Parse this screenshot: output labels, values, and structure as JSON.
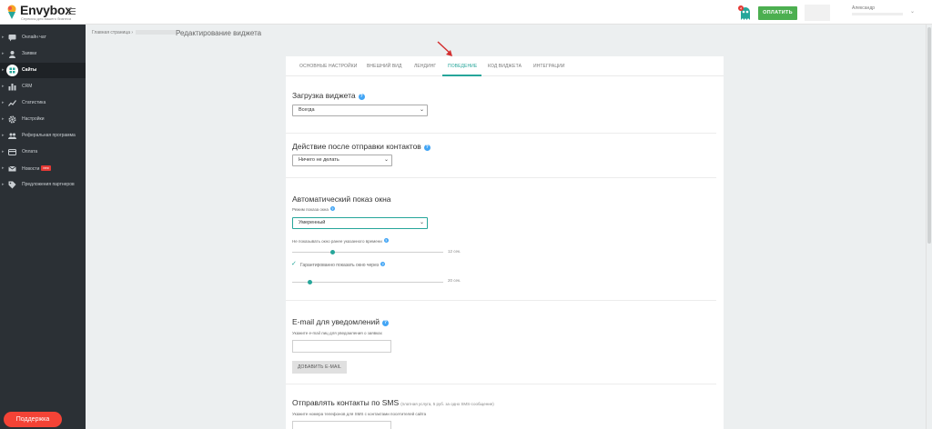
{
  "app": {
    "logo": "Envybox",
    "tagline": "Сервисы для вашего бизнеса",
    "colors": {
      "accent": "#26a69a",
      "sidebar": "#2b3035",
      "pay": "#4caf50",
      "support": "#f44336"
    }
  },
  "header": {
    "pay_label": "ОПЛАТИТЬ",
    "user_name": "Александр",
    "mascot_icon": "ghost-mascot-icon",
    "mascot_badge": "4"
  },
  "sidebar": {
    "items": [
      {
        "label": "Онлайн чат",
        "icon": "chat-icon"
      },
      {
        "label": "Заявки",
        "icon": "user-icon"
      },
      {
        "label": "Сайты",
        "icon": "grid-icon",
        "active": true
      },
      {
        "label": "CRM",
        "icon": "crm-icon"
      },
      {
        "label": "Статистика",
        "icon": "chart-icon"
      },
      {
        "label": "Настройки",
        "icon": "gear-icon"
      },
      {
        "label": "Реферальная программа",
        "icon": "people-icon"
      },
      {
        "label": "Оплата",
        "icon": "card-icon"
      },
      {
        "label": "Новости",
        "icon": "mail-icon",
        "badge": "new"
      },
      {
        "label": "Предложения партнеров",
        "icon": "tag-icon"
      }
    ],
    "support_label": "Поддержка"
  },
  "breadcrumb": {
    "home": "Главная страница",
    "title": "Редактирование виджета"
  },
  "tabs": [
    {
      "label": "ОСНОВНЫЕ НАСТРОЙКИ"
    },
    {
      "label": "ВНЕШНИЙ ВИД"
    },
    {
      "label": "ЛЕНДИНГ"
    },
    {
      "label": "ПОВЕДЕНИЕ",
      "active": true
    },
    {
      "label": "КОД ВИДЖЕТА"
    },
    {
      "label": "ИНТЕГРАЦИИ"
    }
  ],
  "sections": {
    "load": {
      "title": "Загрузка виджета",
      "value": "Всегда"
    },
    "after_submit": {
      "title": "Действие после отправки контактов",
      "value": "Ничего не делать"
    },
    "auto_show": {
      "title": "Автоматический показ окна",
      "mode_label": "Режим показа окна",
      "mode_value": "Умеренный",
      "min_time_label": "Не показывать окно ранее указанного времени",
      "min_time_value": "12 сек.",
      "min_time_fraction": 0.27,
      "guaranteed_label": "Гарантированно показать окно через",
      "guaranteed_checked": true,
      "guaranteed_value": "20 сек.",
      "guaranteed_fraction": 0.12
    },
    "email": {
      "title": "E-mail для уведомлений",
      "hint": "Укажите e-mail лиц для уведомления о заявках",
      "value": "",
      "add_button": "ДОБАВИТЬ E-MAIL"
    },
    "sms": {
      "title": "Отправлять контакты по SMS",
      "note": "(платная услуга, 5 руб. за одно SMS-сообщение)",
      "hint": "Укажите номера телефонов для SMS с контактами посетителей сайта"
    }
  }
}
